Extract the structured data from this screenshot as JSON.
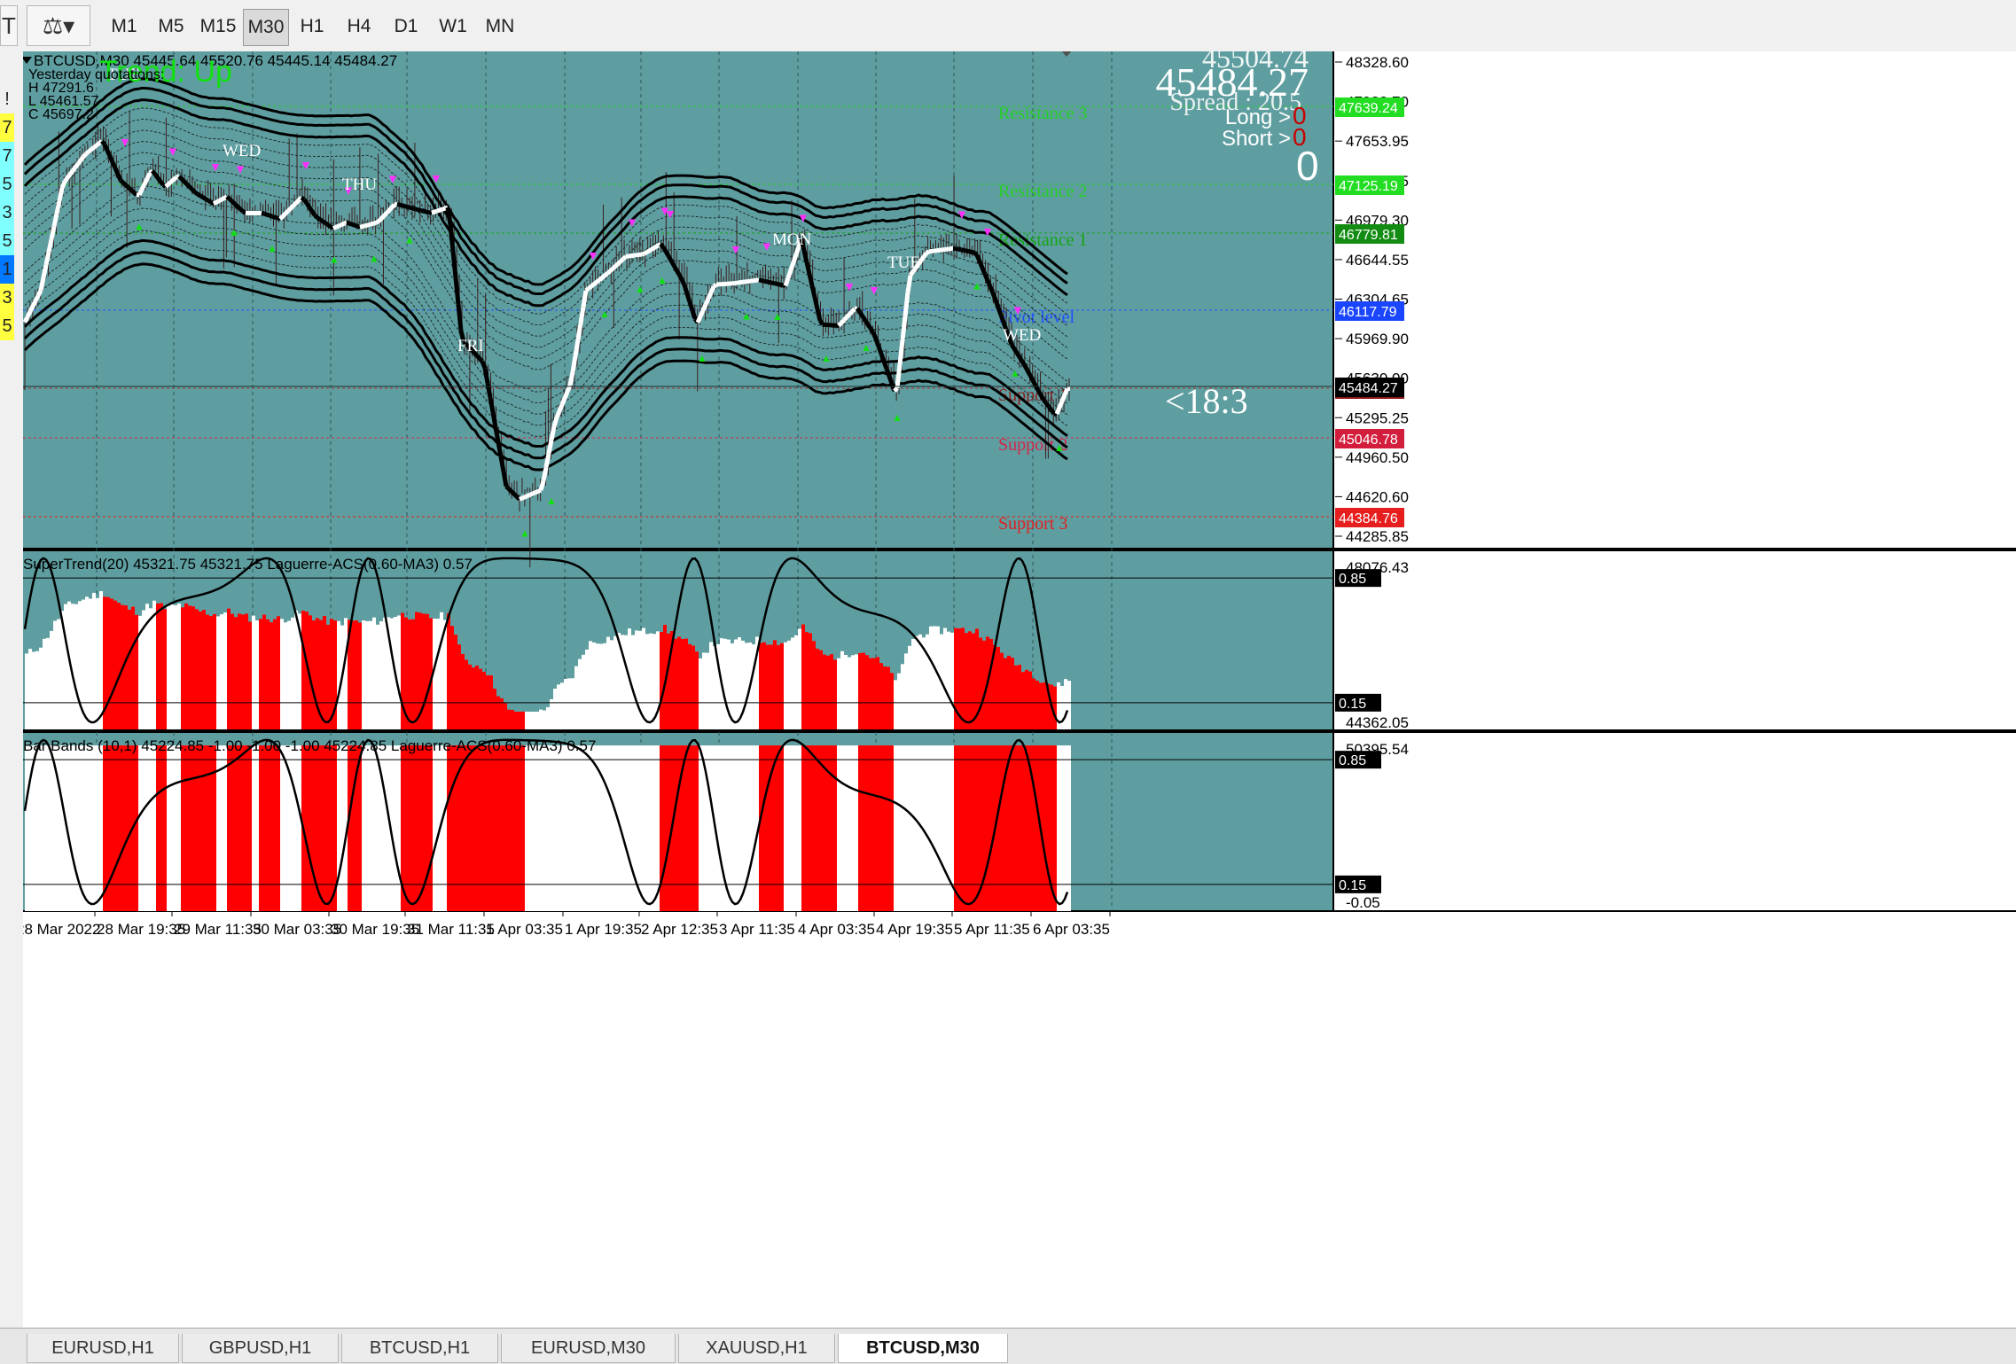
{
  "toolbar": {
    "left_icons": [
      "template-icon",
      "chart-style-icon"
    ],
    "timeframes": [
      "M1",
      "M5",
      "M15",
      "M30",
      "H1",
      "H4",
      "D1",
      "W1",
      "MN"
    ],
    "active_timeframe": "M30"
  },
  "left_strip": [
    "!",
    "7",
    "7",
    "5",
    "3",
    "5",
    "1",
    "3",
    "5"
  ],
  "chart": {
    "header": "BTCUSD,M30  45445.64 45520.76 45445.14 45484.27",
    "yesterday": [
      "Yesterday quotations:",
      "H 47291.6",
      "L 45461.57",
      "C 45697.2"
    ],
    "trend": "Trend: Up",
    "big_price": "45484.27",
    "ask_price": "45504.74",
    "spread": "Spread : 20.5",
    "long": "Long >",
    "long_value": "0",
    "short": "Short >",
    "short_value": "0",
    "big_zero": "0",
    "timer": "<18:3",
    "day_labels": [
      "TUE",
      "WED",
      "THU",
      "FRI",
      "MON",
      "TUE",
      "WED"
    ],
    "levels": [
      {
        "label": "Resistance 3",
        "price": "47639.24",
        "color": "#23cf23"
      },
      {
        "label": "Resistance 2",
        "price": "47125.19",
        "color": "#23cf23"
      },
      {
        "label": "Resistance 1",
        "price": "46779.81",
        "color": "#14a514"
      },
      {
        "label": "Pivot level",
        "price": "46117.79",
        "color": "#2050ff"
      },
      {
        "label": "Support 1",
        "price": "45455.77",
        "color": "#8a1e1e"
      },
      {
        "label": "Support 2",
        "price": "45046.78",
        "color": "#d2284a"
      },
      {
        "label": "Support 3",
        "price": "44384.76",
        "color": "#e02020"
      }
    ],
    "price_axis": [
      "48328.60",
      "47988.70",
      "47653.95",
      "47314.05",
      "46979.30",
      "46644.55",
      "46304.65",
      "45969.90",
      "45630.00",
      "45295.25",
      "44960.50",
      "44620.60",
      "44285.85"
    ],
    "current_price_tag": "45484.27"
  },
  "indicator1": {
    "header": "SuperTrend(20) 45321.75 45321.75  Laguerre-ACS(0.60-MA3) 0.57",
    "axis": [
      "48076.43",
      "0.85",
      "0.15",
      "44362.05"
    ]
  },
  "indicator2": {
    "header": "Bar Bands (10,1) 45224.85 -1.00 -1.00 -1.00 45224.85  Laguerre-ACS(0.60-MA3) 0.57",
    "axis": [
      "50395.54",
      "0.85",
      "0.15",
      "-0.05"
    ]
  },
  "time_axis": [
    "28 Mar 2022",
    "28 Mar 19:35",
    "29 Mar 11:35",
    "30 Mar 03:35",
    "30 Mar 19:35",
    "31 Mar 11:35",
    "1 Apr 03:35",
    "1 Apr 19:35",
    "2 Apr 12:35",
    "3 Apr 11:35",
    "4 Apr 03:35",
    "4 Apr 19:35",
    "5 Apr 11:35",
    "6 Apr 03:35"
  ],
  "tabs": [
    "EURUSD,H1",
    "GBPUSD,H1",
    "BTCUSD,H1",
    "EURUSD,M30",
    "XAUUSD,H1",
    "BTCUSD,M30"
  ],
  "active_tab": "BTCUSD,M30",
  "colors": {
    "chart_bg": "#5f9ea0",
    "bull": "#ffffff",
    "bear": "#000000",
    "hist_red": "#ff0000"
  }
}
